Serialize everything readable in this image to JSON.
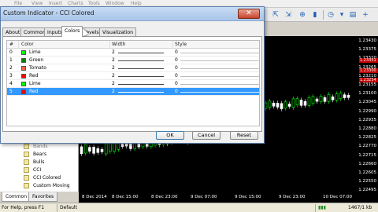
{
  "menubar": {
    "items": [
      "File",
      "View",
      "Insert",
      "Charts",
      "Tools",
      "Window",
      "Help"
    ]
  },
  "toolbar": {
    "icons": [
      "new-chart-icon",
      "profiles-icon",
      "market-watch-icon",
      "data-window-icon",
      "navigator-icon",
      "terminal-icon",
      "crosshair-icon",
      "zoom-in-icon",
      "zoom-out-icon",
      "bar-chart-icon",
      "candlestick-icon",
      "line-chart-icon",
      "indicators-icon",
      "period-icon",
      "templates-icon"
    ]
  },
  "dialog": {
    "title": "Custom Indicator - CCI Colored",
    "close_label": "✕",
    "tabs": [
      "About",
      "Common",
      "Inputs",
      "Colors",
      "Levels",
      "Visualization"
    ],
    "active_tab": "Colors",
    "columns": [
      "#",
      "Color",
      "Width",
      "Style"
    ],
    "rows": [
      {
        "index": "0",
        "color_name": "Lime",
        "color": "#00ff00",
        "width": "2",
        "style": "0"
      },
      {
        "index": "1",
        "color_name": "Green",
        "color": "#008000",
        "width": "2",
        "style": "0"
      },
      {
        "index": "2",
        "color_name": "Tomato",
        "color": "#ff6347",
        "width": "2",
        "style": "0"
      },
      {
        "index": "3",
        "color_name": "Red",
        "color": "#ff0000",
        "width": "2",
        "style": "0"
      },
      {
        "index": "4",
        "color_name": "Lime",
        "color": "#00ff00",
        "width": "2",
        "style": "0"
      },
      {
        "index": "5",
        "color_name": "Red",
        "color": "#ff0000",
        "width": "2",
        "style": "0",
        "selected": true
      }
    ],
    "buttons": {
      "ok": "OK",
      "cancel": "Cancel",
      "reset": "Reset"
    }
  },
  "navigator": {
    "items": [
      "Bears",
      "Bulls",
      "CCI",
      "CCI Colored",
      "Custom Moving"
    ],
    "partial_top": "Bands",
    "tabs": [
      "Common",
      "Favorites"
    ]
  },
  "chart": {
    "prices": [
      "1.23430",
      "1.23375",
      "1.23320",
      "1.23265",
      "1.23210",
      "1.23155",
      "1.23100",
      "1.23045",
      "1.22990",
      "1.22935",
      "1.22880",
      "1.22825",
      "1.22770",
      "1.22715",
      "1.22660",
      "1.22605",
      "1.22550",
      "1.22495"
    ],
    "markers": [
      "1.23351",
      "1.23300",
      "1.23254"
    ],
    "dates": [
      "8 Dec 2014",
      "8 Dec 15:00",
      "8 Dec 23:00",
      "9 Dec 07:00",
      "9 Dec 15:00",
      "9 Dec 23:00",
      "10 Dec 07:00"
    ],
    "colors": {
      "bull": "#00ff00",
      "bear": "#ffffff",
      "background": "#000000"
    }
  },
  "statusbar": {
    "help": "For Help, press F1",
    "profile": "Default",
    "traffic": "1467/1 kb"
  }
}
